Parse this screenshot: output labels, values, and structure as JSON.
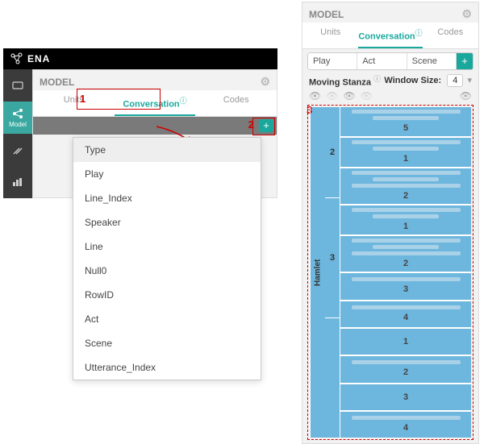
{
  "app": {
    "name": "ENA"
  },
  "rail": {
    "items": [
      {
        "icon": "box",
        "label": ""
      },
      {
        "icon": "share",
        "label": "Model"
      },
      {
        "icon": "tools",
        "label": ""
      },
      {
        "icon": "stats",
        "label": ""
      }
    ]
  },
  "panel_title": "MODEL",
  "tabs": {
    "units": "Units",
    "conversation": "Conversation",
    "codes": "Codes"
  },
  "dropdown_items": [
    "Type",
    "Play",
    "Line_Index",
    "Speaker",
    "Line",
    "Null0",
    "RowID",
    "Act",
    "Scene",
    "Utterance_Index"
  ],
  "selects": {
    "a": "Play",
    "b": "Act",
    "c": "Scene"
  },
  "moving_stanza_label": "Moving Stanza",
  "window_size_label": "Window Size:",
  "window_size_value": "4",
  "annotations": {
    "one": "1",
    "two": "2",
    "three": "3"
  },
  "chart_data": {
    "type": "table",
    "play": "Hamlet",
    "acts": [
      {
        "act": "2",
        "scenes": [
          {
            "scene": "5",
            "lines": 2
          },
          {
            "scene": "1",
            "lines": 2
          },
          {
            "scene": "2",
            "lines": 3
          }
        ]
      },
      {
        "act": "3",
        "scenes": [
          {
            "scene": "1",
            "lines": 2
          },
          {
            "scene": "2",
            "lines": 3
          },
          {
            "scene": "3",
            "lines": 1
          },
          {
            "scene": "4",
            "lines": 1
          }
        ]
      },
      {
        "act": "",
        "scenes": [
          {
            "scene": "1",
            "lines": 0
          },
          {
            "scene": "2",
            "lines": 1
          },
          {
            "scene": "3",
            "lines": 0
          },
          {
            "scene": "4",
            "lines": 1
          }
        ]
      }
    ]
  }
}
